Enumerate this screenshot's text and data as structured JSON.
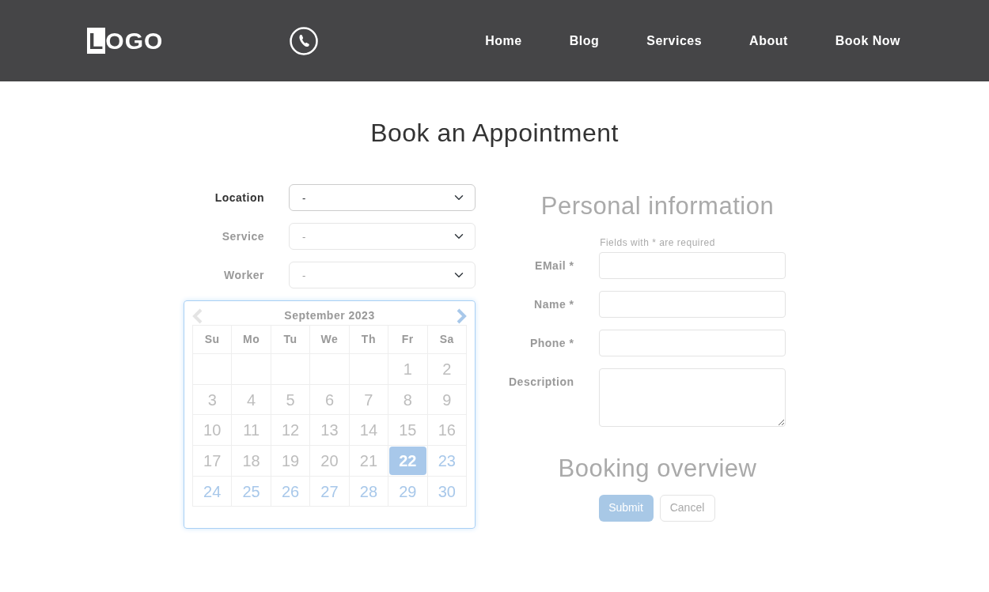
{
  "header": {
    "logo": "LOGO",
    "nav": [
      {
        "label": "Home"
      },
      {
        "label": "Blog"
      },
      {
        "label": "Services"
      },
      {
        "label": "About"
      },
      {
        "label": "Book Now"
      }
    ]
  },
  "title": "Book an Appointment",
  "selects": [
    {
      "label": "Location",
      "value": "-",
      "disabled": false
    },
    {
      "label": "Service",
      "value": "-",
      "disabled": true
    },
    {
      "label": "Worker",
      "value": "-",
      "disabled": true
    }
  ],
  "calendar": {
    "month": "September 2023",
    "prev_disabled": true,
    "next_disabled": false,
    "weekdays": [
      "Su",
      "Mo",
      "Tu",
      "We",
      "Th",
      "Fr",
      "Sa"
    ],
    "weeks": [
      [
        {
          "kind": "blank"
        },
        {
          "kind": "blank"
        },
        {
          "kind": "blank"
        },
        {
          "kind": "blank"
        },
        {
          "kind": "blank"
        },
        {
          "kind": "day",
          "day": "1",
          "disabled": true,
          "selected": false
        },
        {
          "kind": "day",
          "day": "2",
          "disabled": true,
          "selected": false
        }
      ],
      [
        {
          "kind": "day",
          "day": "3",
          "disabled": true,
          "selected": false
        },
        {
          "kind": "day",
          "day": "4",
          "disabled": true,
          "selected": false
        },
        {
          "kind": "day",
          "day": "5",
          "disabled": true,
          "selected": false
        },
        {
          "kind": "day",
          "day": "6",
          "disabled": true,
          "selected": false
        },
        {
          "kind": "day",
          "day": "7",
          "disabled": true,
          "selected": false
        },
        {
          "kind": "day",
          "day": "8",
          "disabled": true,
          "selected": false
        },
        {
          "kind": "day",
          "day": "9",
          "disabled": true,
          "selected": false
        }
      ],
      [
        {
          "kind": "day",
          "day": "10",
          "disabled": true,
          "selected": false
        },
        {
          "kind": "day",
          "day": "11",
          "disabled": true,
          "selected": false
        },
        {
          "kind": "day",
          "day": "12",
          "disabled": true,
          "selected": false
        },
        {
          "kind": "day",
          "day": "13",
          "disabled": true,
          "selected": false
        },
        {
          "kind": "day",
          "day": "14",
          "disabled": true,
          "selected": false
        },
        {
          "kind": "day",
          "day": "15",
          "disabled": true,
          "selected": false
        },
        {
          "kind": "day",
          "day": "16",
          "disabled": true,
          "selected": false
        }
      ],
      [
        {
          "kind": "day",
          "day": "17",
          "disabled": true,
          "selected": false
        },
        {
          "kind": "day",
          "day": "18",
          "disabled": true,
          "selected": false
        },
        {
          "kind": "day",
          "day": "19",
          "disabled": true,
          "selected": false
        },
        {
          "kind": "day",
          "day": "20",
          "disabled": true,
          "selected": false
        },
        {
          "kind": "day",
          "day": "21",
          "disabled": true,
          "selected": false
        },
        {
          "kind": "day",
          "day": "22",
          "disabled": false,
          "selected": true
        },
        {
          "kind": "day",
          "day": "23",
          "disabled": false,
          "selected": false
        }
      ],
      [
        {
          "kind": "day",
          "day": "24",
          "disabled": false,
          "selected": false
        },
        {
          "kind": "day",
          "day": "25",
          "disabled": false,
          "selected": false
        },
        {
          "kind": "day",
          "day": "26",
          "disabled": false,
          "selected": false
        },
        {
          "kind": "day",
          "day": "27",
          "disabled": false,
          "selected": false
        },
        {
          "kind": "day",
          "day": "28",
          "disabled": false,
          "selected": false
        },
        {
          "kind": "day",
          "day": "29",
          "disabled": false,
          "selected": false
        },
        {
          "kind": "day",
          "day": "30",
          "disabled": false,
          "selected": false
        }
      ]
    ]
  },
  "personal": {
    "heading": "Personal information",
    "note": "Fields with * are required",
    "fields": [
      {
        "label": "EMail *",
        "kind": "input"
      },
      {
        "label": "Name *",
        "kind": "input"
      },
      {
        "label": "Phone *",
        "kind": "input"
      },
      {
        "label": "Description",
        "kind": "textarea"
      }
    ]
  },
  "overview": {
    "heading": "Booking overview",
    "submit": {
      "label": "Submit",
      "disabled": true
    },
    "cancel": {
      "label": "Cancel"
    }
  }
}
